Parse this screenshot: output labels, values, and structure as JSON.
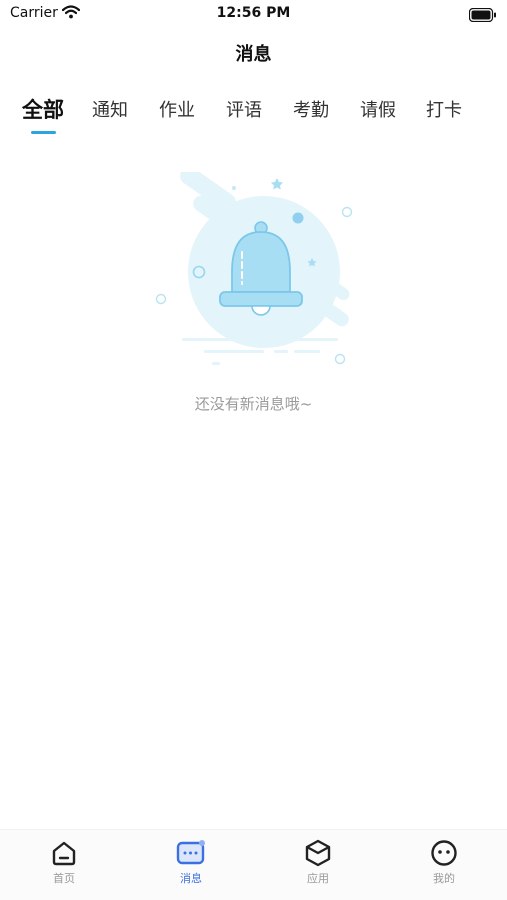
{
  "status_bar": {
    "carrier": "Carrier",
    "time": "12:56 PM"
  },
  "nav": {
    "title": "消息"
  },
  "tabs": [
    {
      "label": "全部",
      "active": true
    },
    {
      "label": "通知"
    },
    {
      "label": "作业"
    },
    {
      "label": "评语"
    },
    {
      "label": "考勤"
    },
    {
      "label": "请假"
    },
    {
      "label": "打卡"
    }
  ],
  "empty_state": {
    "icon": "bell-icon",
    "message": "还没有新消息哦~"
  },
  "tabbar": {
    "items": [
      {
        "label": "首页",
        "icon": "home-icon"
      },
      {
        "label": "消息",
        "icon": "message-icon",
        "active": true
      },
      {
        "label": "应用",
        "icon": "apps-icon"
      },
      {
        "label": "我的",
        "icon": "profile-icon"
      }
    ]
  },
  "colors": {
    "accent": "#2aa5e0",
    "tabbar_active": "#3d6fe0",
    "bell": "#a8def3"
  }
}
